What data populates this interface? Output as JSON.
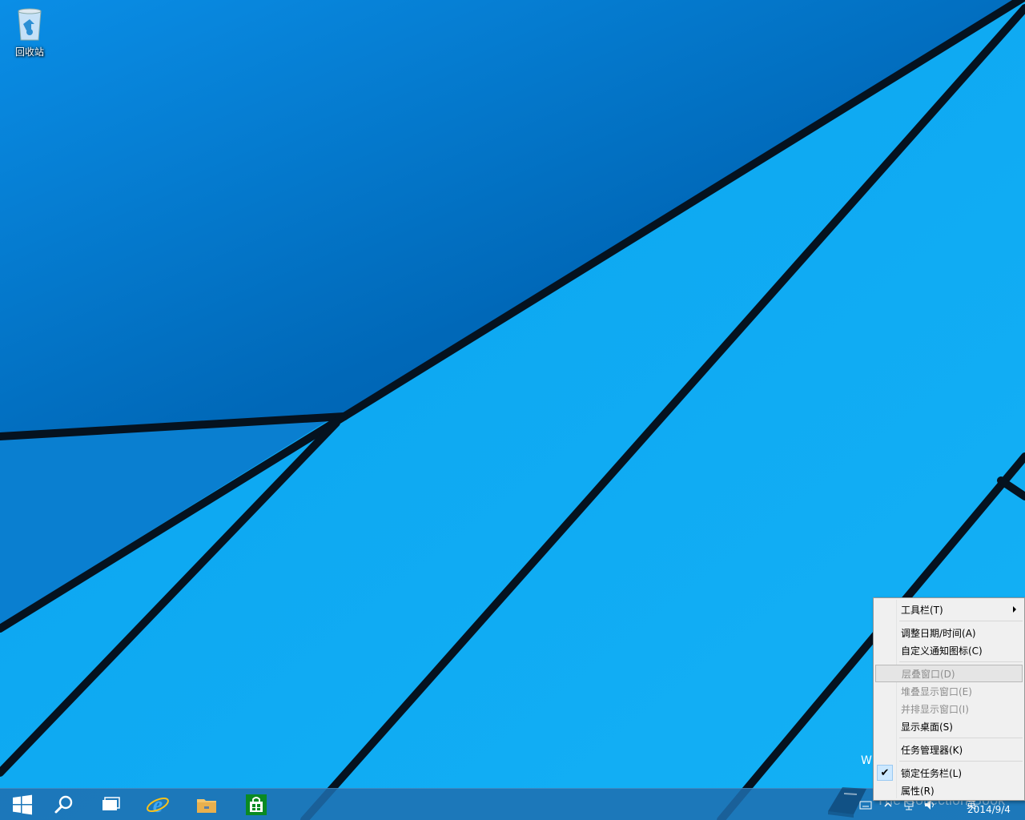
{
  "desktop": {
    "icons": [
      {
        "label": "回收站",
        "icon": "recycle-bin-icon"
      }
    ]
  },
  "taskbar": {
    "buttons": [
      {
        "name": "start-button",
        "icon": "windows-logo-icon"
      },
      {
        "name": "search-button",
        "icon": "search-icon"
      },
      {
        "name": "task-view-button",
        "icon": "task-view-icon"
      },
      {
        "name": "internet-explorer-button",
        "icon": "internet-explorer-icon"
      },
      {
        "name": "file-explorer-button",
        "icon": "folder-icon"
      },
      {
        "name": "store-button",
        "icon": "store-icon"
      }
    ],
    "tray": {
      "ime": "英",
      "date": "2014/9/4"
    }
  },
  "context_menu": {
    "items": [
      {
        "label": "工具栏(T)",
        "has_submenu": true,
        "enabled": true
      },
      {
        "label": "调整日期/时间(A)",
        "enabled": true
      },
      {
        "label": "自定义通知图标(C)",
        "enabled": true
      },
      {
        "label": "层叠窗口(D)",
        "enabled": false,
        "highlighted": true
      },
      {
        "label": "堆叠显示窗口(E)",
        "enabled": false
      },
      {
        "label": "并排显示窗口(I)",
        "enabled": false
      },
      {
        "label": "显示桌面(S)",
        "enabled": true
      },
      {
        "label": "任务管理器(K)",
        "enabled": true
      },
      {
        "label": "锁定任务栏(L)",
        "enabled": true,
        "checked": true
      },
      {
        "label": "属性(R)",
        "enabled": true
      }
    ]
  },
  "watermark": {
    "text": "The Collection Book",
    "letter": "W"
  },
  "colors": {
    "wallpaper": "#0078d7",
    "taskbar": "#1e6eaf",
    "menu_bg": "#f0f0f0",
    "check_bg": "#cce8ff"
  }
}
